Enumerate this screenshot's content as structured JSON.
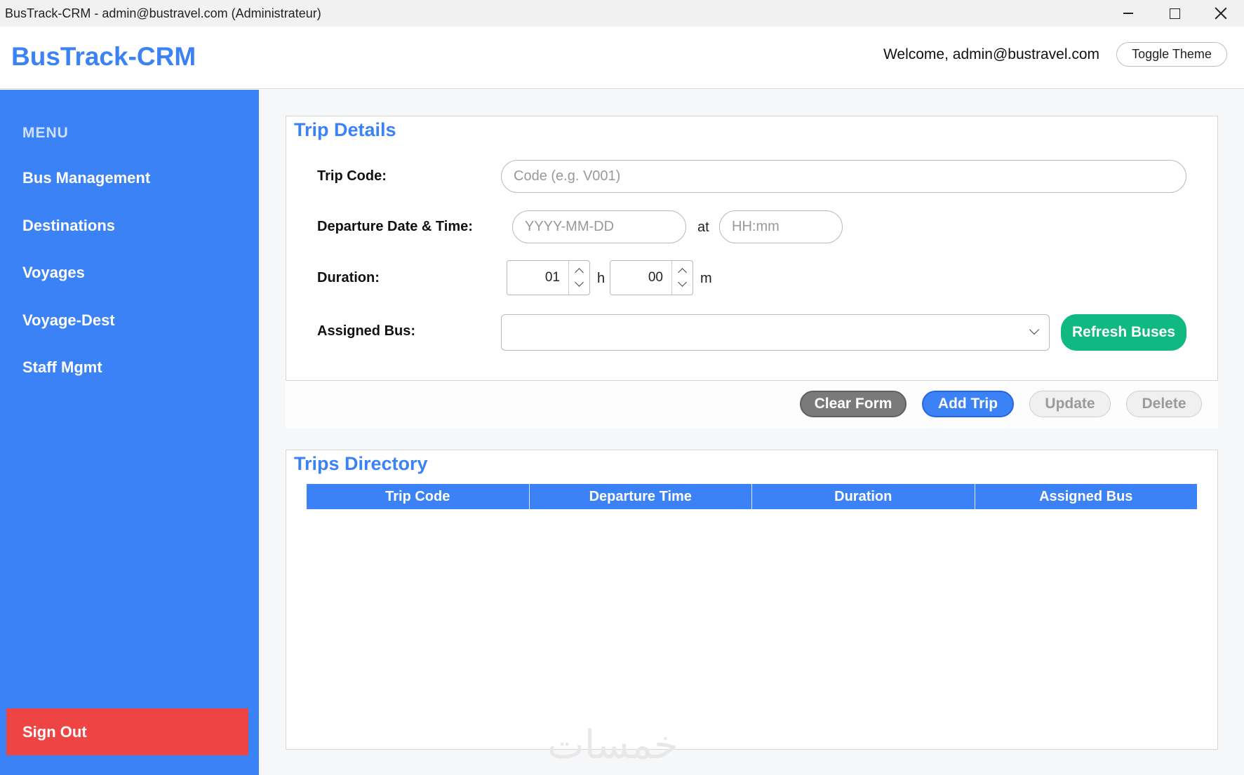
{
  "window": {
    "title": "BusTrack-CRM - admin@bustravel.com (Administrateur)"
  },
  "header": {
    "brand": "BusTrack-CRM",
    "welcome": "Welcome, admin@bustravel.com",
    "toggle_theme": "Toggle Theme"
  },
  "sidebar": {
    "menu_title": "MENU",
    "items": [
      {
        "label": "Bus Management"
      },
      {
        "label": "Destinations"
      },
      {
        "label": "Voyages"
      },
      {
        "label": "Voyage-Dest"
      },
      {
        "label": "Staff Mgmt"
      }
    ],
    "sign_out": "Sign Out"
  },
  "trip_details": {
    "title": "Trip Details",
    "trip_code_label": "Trip Code:",
    "trip_code_placeholder": "Code (e.g. V001)",
    "departure_label": "Departure Date & Time:",
    "date_placeholder": "YYYY-MM-DD",
    "at_text": "at",
    "time_placeholder": "HH:mm",
    "duration_label": "Duration:",
    "hours_value": "01",
    "hours_unit": "h",
    "minutes_value": "00",
    "minutes_unit": "m",
    "bus_label": "Assigned Bus:",
    "bus_value": "",
    "refresh_button": "Refresh Buses"
  },
  "actions": {
    "clear": "Clear Form",
    "add": "Add Trip",
    "update": "Update",
    "delete": "Delete"
  },
  "trips_directory": {
    "title": "Trips Directory",
    "columns": [
      "Trip Code",
      "Departure Time",
      "Duration",
      "Assigned Bus"
    ],
    "rows": []
  },
  "watermark": "خمسات",
  "colors": {
    "accent": "#3b82f6",
    "success": "#10b981",
    "danger": "#ef4444"
  }
}
